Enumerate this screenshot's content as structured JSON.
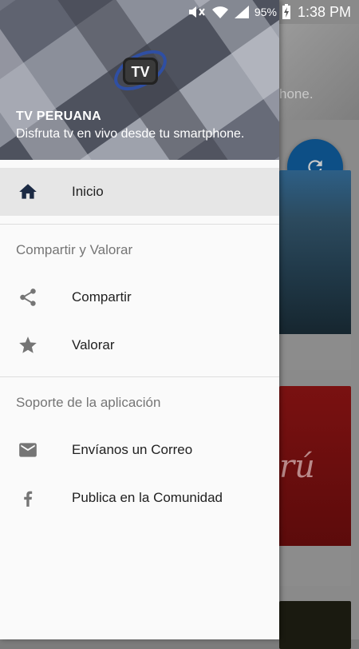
{
  "status_bar": {
    "battery_percent": "95%",
    "time": "1:38 PM"
  },
  "background": {
    "partial_text": "hone.",
    "card_text": "rú"
  },
  "drawer": {
    "header": {
      "title": "TV PERUANA",
      "subtitle": "Disfruta tv en vivo desde tu smartphone.",
      "logo_text": "TV"
    },
    "items": [
      {
        "label": "Inicio",
        "icon": "home-icon",
        "active": true
      }
    ],
    "sections": [
      {
        "title": "Compartir y Valorar",
        "items": [
          {
            "label": "Compartir",
            "icon": "share-icon"
          },
          {
            "label": "Valorar",
            "icon": "star-icon"
          }
        ]
      },
      {
        "title": "Soporte de la aplicación",
        "items": [
          {
            "label": "Envíanos un Correo",
            "icon": "mail-icon"
          },
          {
            "label": "Publica en la Comunidad",
            "icon": "facebook-icon"
          }
        ]
      }
    ]
  },
  "colors": {
    "accent_fab": "#0d4f86",
    "active_row": "#e6e6e6"
  }
}
